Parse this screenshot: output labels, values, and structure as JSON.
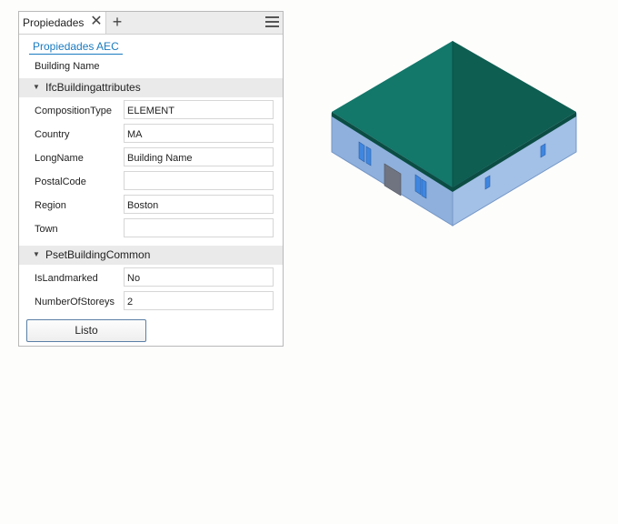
{
  "panel": {
    "tab_title": "Propiedades",
    "close_glyph": "✕",
    "add_glyph": "+",
    "aec_link": "Propiedades AEC",
    "building_name": "Building Name",
    "done_label": "Listo"
  },
  "sections": [
    {
      "title": "IfcBuildingattributes",
      "properties": [
        {
          "label": "CompositionType",
          "value": "ELEMENT"
        },
        {
          "label": "Country",
          "value": "MA"
        },
        {
          "label": "LongName",
          "value": "Building Name"
        },
        {
          "label": "PostalCode",
          "value": ""
        },
        {
          "label": "Region",
          "value": "Boston"
        },
        {
          "label": "Town",
          "value": ""
        }
      ]
    },
    {
      "title": "PsetBuildingCommon",
      "properties": [
        {
          "label": "IsLandmarked",
          "value": "No"
        },
        {
          "label": "NumberOfStoreys",
          "value": "2"
        }
      ]
    }
  ],
  "icons": {
    "close": "close-icon",
    "add": "plus-icon",
    "menu": "hamburger-menu-icon",
    "section_toggle": "caret-down-icon"
  },
  "colors": {
    "link": "#1a7bc0",
    "roof": "#11695b",
    "walls": "#8fb0dc",
    "windows": "#3f86e0",
    "door": "#6f7480"
  }
}
